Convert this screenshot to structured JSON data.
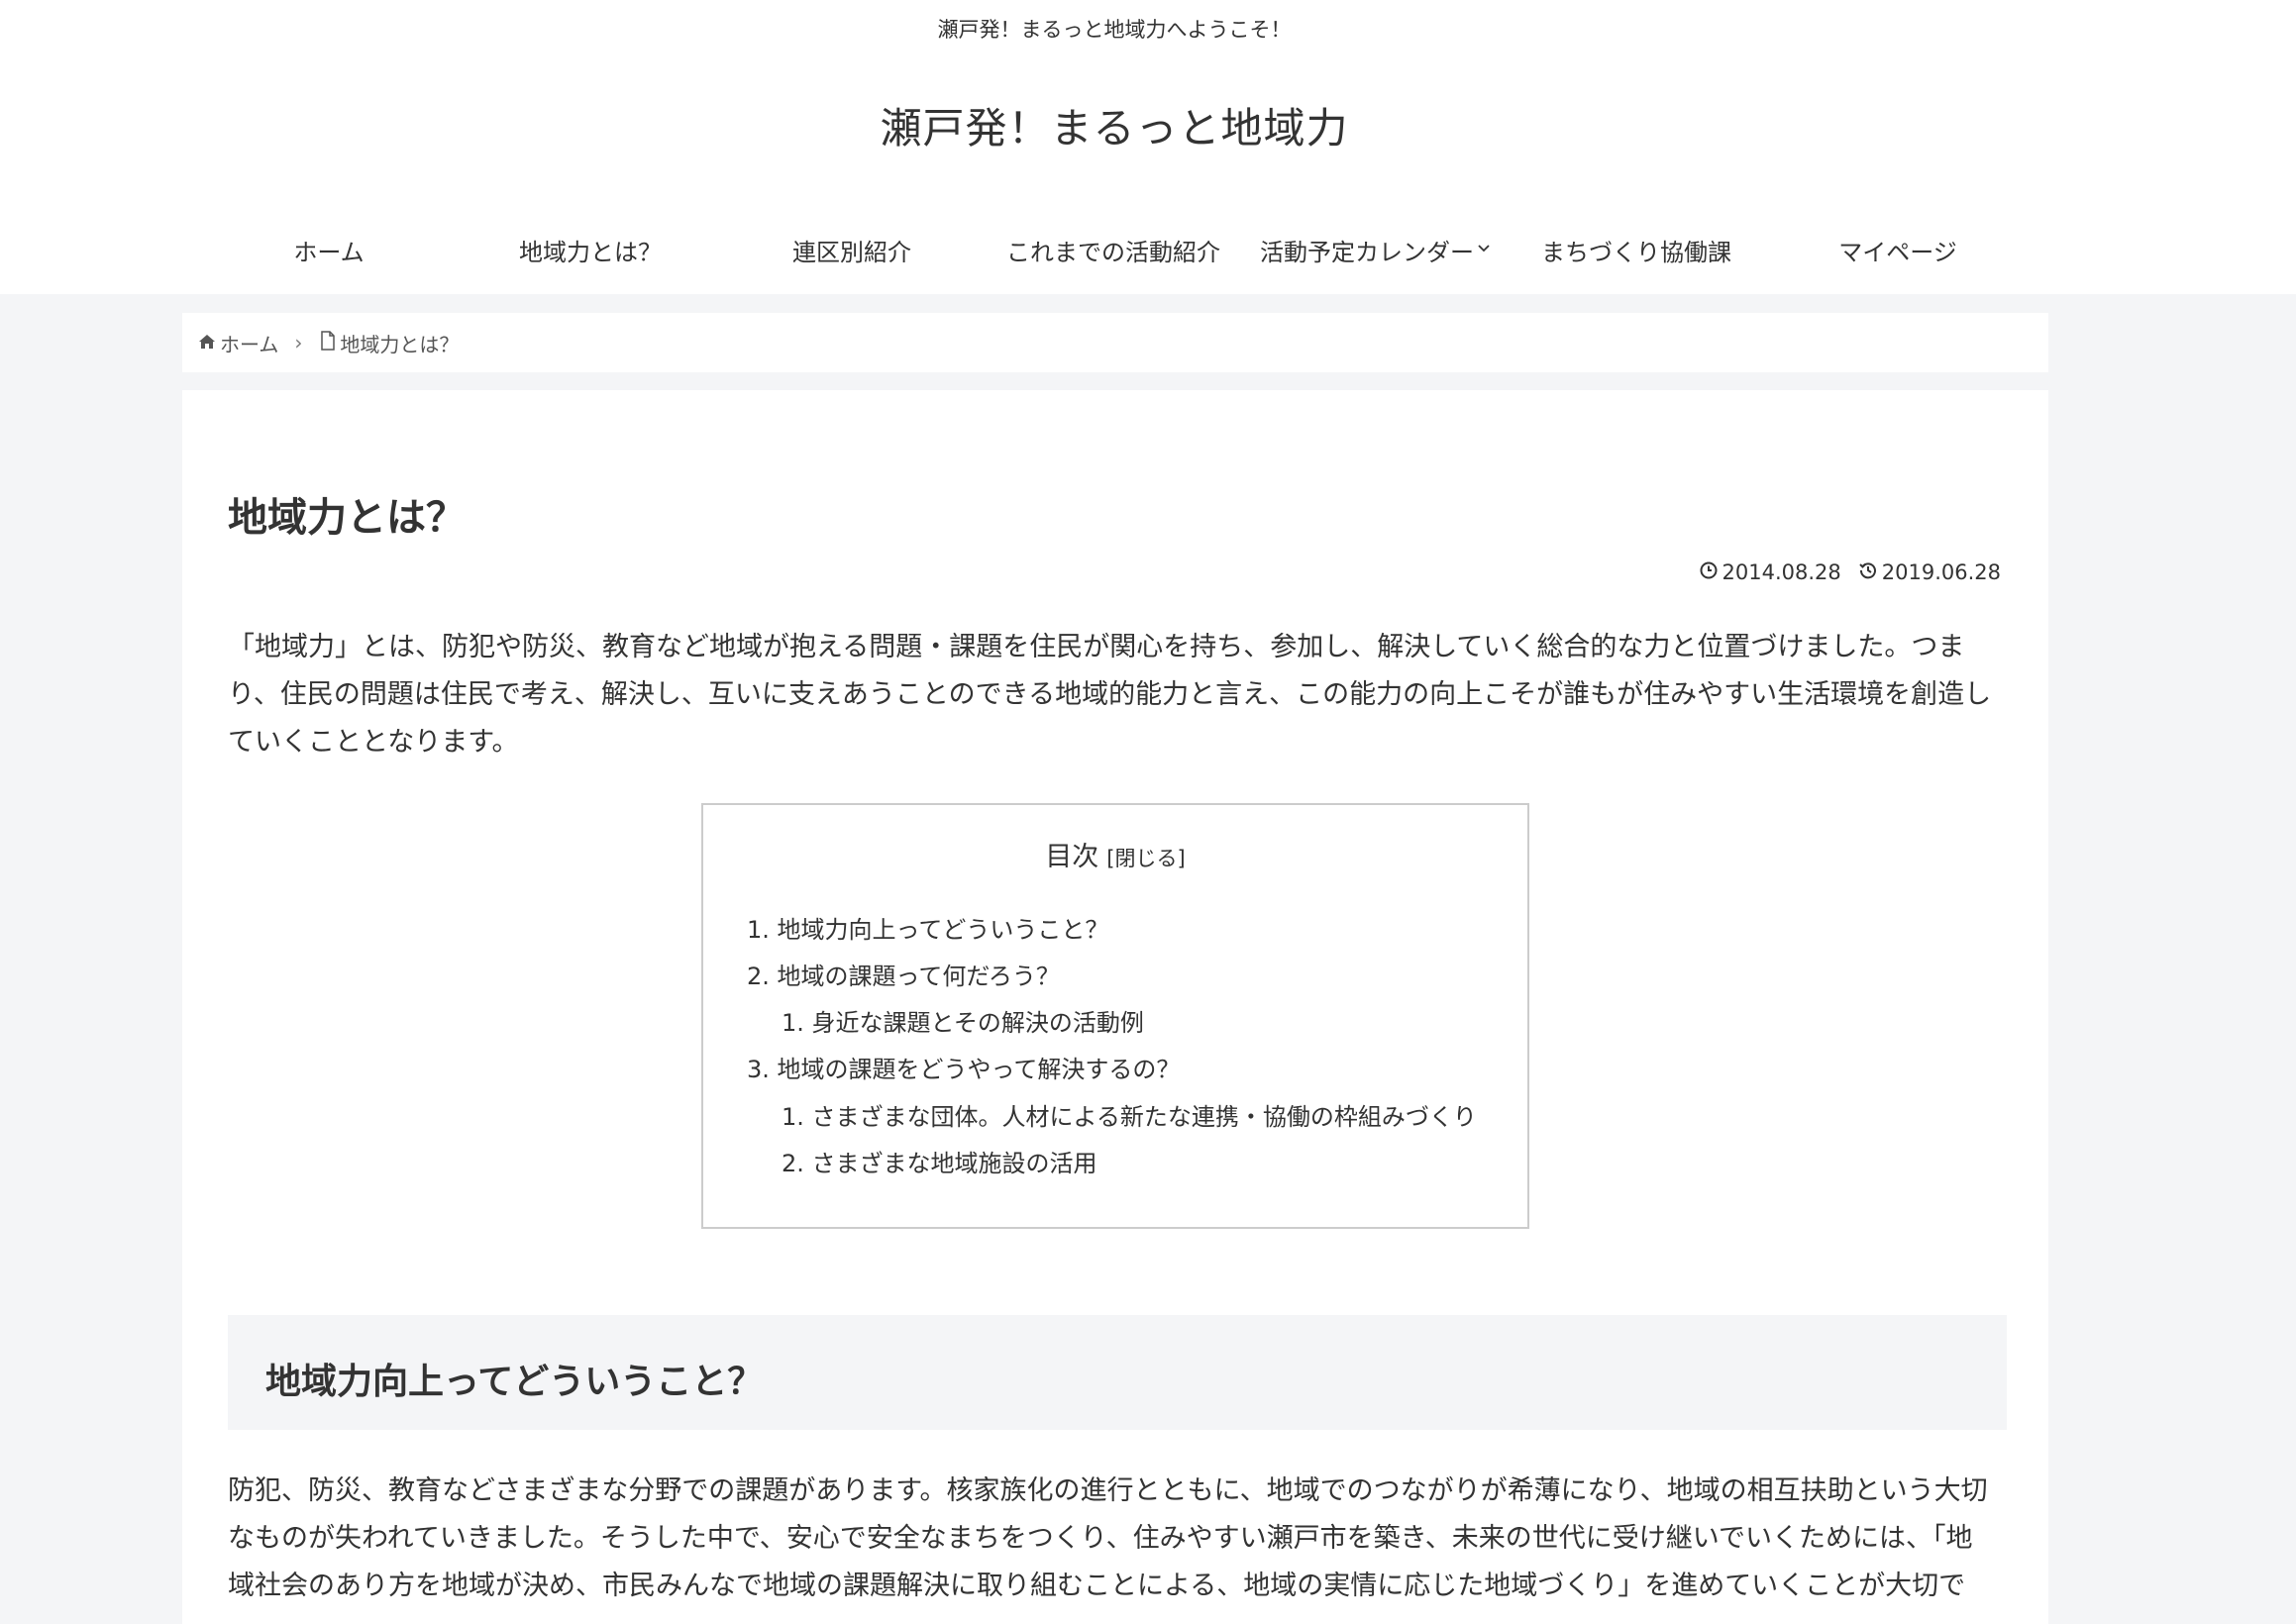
{
  "header": {
    "tagline": "瀬戸発！まるっと地域力へようこそ！",
    "site_title": "瀬戸発！まるっと地域力"
  },
  "navi": [
    {
      "label": "ホーム"
    },
    {
      "label": "地域力とは？"
    },
    {
      "label": "連区別紹介"
    },
    {
      "label": "これまでの活動紹介"
    },
    {
      "label": "活動予定カレンダー"
    },
    {
      "label": "まちづくり協働課"
    },
    {
      "label": "マイページ"
    }
  ],
  "breadcrumb": {
    "home": "ホーム",
    "current": "地域力とは？"
  },
  "article": {
    "title": "地域力とは？",
    "posted": "2014.08.28",
    "updated": "2019.06.28",
    "intro_lines": [
      "「地域力」とは、防犯や防災、教育など地域が抱える問題・課題を住民が関心を持ち、参加し、解決していく総合的な力と位置づけました。つま",
      "り、住民の問題は住民で考え、解決し、互いに支えあうことのできる地域的能力と言え、この能力の向上こそが誰もが住みやすい生活環境を創造し",
      "ていくこととなります。"
    ],
    "toc": {
      "title": "目次",
      "toggle": "[閉じる]",
      "items": [
        {
          "num": "1.",
          "text": "地域力向上ってどういうこと？"
        },
        {
          "num": "2.",
          "text": "地域の課題って何だろう？"
        },
        {
          "num": "1.",
          "text": "身近な課題とその解決の活動例"
        },
        {
          "num": "3.",
          "text": "地域の課題をどうやって解決するの？"
        },
        {
          "num": "1.",
          "text": "さまざまな団体。人材による新たな連携・協働の枠組みづくり"
        },
        {
          "num": "2.",
          "text": "さまざまな地域施設の活用"
        }
      ]
    },
    "section1_heading": "地域力向上ってどういうこと？",
    "section1_lines": [
      "防犯、防災、教育などさまざまな分野での課題があります。核家族化の進行とともに、地域でのつながりが希薄になり、地域の相互扶助という大切",
      "なものが失われていきました。そうした中で、安心で安全なまちをつくり、住みやすい瀬戸市を築き、未来の世代に受け継いでいくためには、「地",
      "域社会のあり方を地域が決め、市民みんなで地域の課題解決に取り組むことによる、地域の実情に応じた地域づくり」を進めていくことが大切で"
    ]
  }
}
